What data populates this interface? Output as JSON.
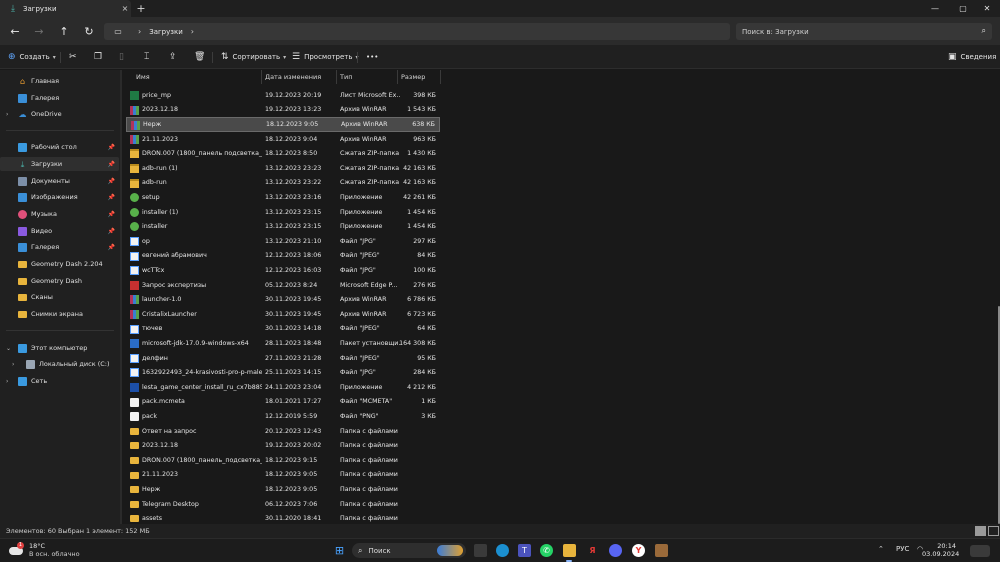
{
  "window": {
    "tab_title": "Загрузки",
    "new_tab": "+",
    "tab_close": "×",
    "controls": {
      "minimize": "—",
      "maximize": "▢",
      "close": "✕"
    }
  },
  "address": {
    "back": "←",
    "forward": "→",
    "up": "↑",
    "refresh": "↻",
    "breadcrumb": "Загрузки",
    "search_placeholder": "Поиск в: Загрузки"
  },
  "toolbar": {
    "new_label": "Создать",
    "sort_label": "Сортировать",
    "view_label": "Просмотреть",
    "more_label": "•••",
    "details_label": "Сведения"
  },
  "sidebar": {
    "items": [
      {
        "label": "Главная"
      },
      {
        "label": "Галерея"
      },
      {
        "label": "OneDrive"
      },
      {
        "label": "Рабочий стол"
      },
      {
        "label": "Загрузки"
      },
      {
        "label": "Документы"
      },
      {
        "label": "Изображения"
      },
      {
        "label": "Музыка"
      },
      {
        "label": "Видео"
      },
      {
        "label": "Галерея"
      },
      {
        "label": "Geometry Dash 2.204"
      },
      {
        "label": "Geometry Dash"
      },
      {
        "label": "Сканы"
      },
      {
        "label": "Снимки экрана"
      },
      {
        "label": "Этот компьютер"
      },
      {
        "label": "Локальный диск (C:)"
      },
      {
        "label": "Сеть"
      }
    ]
  },
  "columns": {
    "name": "Имя",
    "date": "Дата изменения",
    "type": "Тип",
    "size": "Размер"
  },
  "files": [
    {
      "name": "price_mp",
      "date": "19.12.2023 20:19",
      "type": "Лист Microsoft Ex...",
      "size": "398 КБ",
      "icon": "excel-icon"
    },
    {
      "name": "2023.12.18",
      "date": "19.12.2023 13:23",
      "type": "Архив WinRAR",
      "size": "1 543 КБ",
      "icon": "winrar-icon"
    },
    {
      "name": "Нерж",
      "date": "18.12.2023 9:05",
      "type": "Архив WinRAR",
      "size": "638 КБ",
      "icon": "winrar-icon"
    },
    {
      "name": "21.11.2023",
      "date": "18.12.2023 9:04",
      "type": "Архив WinRAR",
      "size": "963 КБ",
      "icon": "winrar-icon"
    },
    {
      "name": "DRON.007 (1800_панель подсветка_с_н...",
      "date": "18.12.2023 8:50",
      "type": "Сжатая ZIP-папка",
      "size": "1 430 КБ",
      "icon": "zip-folder-icon"
    },
    {
      "name": "adb-run (1)",
      "date": "13.12.2023 23:23",
      "type": "Сжатая ZIP-папка",
      "size": "42 163 КБ",
      "icon": "zip-folder-icon"
    },
    {
      "name": "adb-run",
      "date": "13.12.2023 23:22",
      "type": "Сжатая ZIP-папка",
      "size": "42 163 КБ",
      "icon": "zip-folder-icon"
    },
    {
      "name": "setup",
      "date": "13.12.2023 23:16",
      "type": "Приложение",
      "size": "42 261 КБ",
      "icon": "setup-icon"
    },
    {
      "name": "installer (1)",
      "date": "13.12.2023 23:15",
      "type": "Приложение",
      "size": "1 454 КБ",
      "icon": "installer-icon"
    },
    {
      "name": "installer",
      "date": "13.12.2023 23:15",
      "type": "Приложение",
      "size": "1 454 КБ",
      "icon": "installer-icon"
    },
    {
      "name": "op",
      "date": "13.12.2023 21:10",
      "type": "Файл \"JPG\"",
      "size": "297 КБ",
      "icon": "image-file-icon"
    },
    {
      "name": "евгений абрамович",
      "date": "12.12.2023 18:06",
      "type": "Файл \"JPEG\"",
      "size": "84 КБ",
      "icon": "image-file-icon"
    },
    {
      "name": "wcTTcx",
      "date": "12.12.2023 16:03",
      "type": "Файл \"JPG\"",
      "size": "100 КБ",
      "icon": "image-file-icon"
    },
    {
      "name": "Запрос экспертизы",
      "date": "05.12.2023 8:24",
      "type": "Microsoft Edge P...",
      "size": "276 КБ",
      "icon": "pdf-icon"
    },
    {
      "name": "launcher-1.0",
      "date": "30.11.2023 19:45",
      "type": "Архив WinRAR",
      "size": "6 786 КБ",
      "icon": "winrar-icon"
    },
    {
      "name": "CristalixLauncher",
      "date": "30.11.2023 19:45",
      "type": "Архив WinRAR",
      "size": "6 723 КБ",
      "icon": "winrar-icon"
    },
    {
      "name": "тючев",
      "date": "30.11.2023 14:18",
      "type": "Файл \"JPEG\"",
      "size": "64 КБ",
      "icon": "image-file-icon"
    },
    {
      "name": "microsoft-jdk-17.0.9-windows-x64",
      "date": "28.11.2023 18:48",
      "type": "Пакет установщи...",
      "size": "164 308 КБ",
      "icon": "msi-icon"
    },
    {
      "name": "делфин",
      "date": "27.11.2023 21:28",
      "type": "Файл \"JPEG\"",
      "size": "95 КБ",
      "icon": "image-file-icon"
    },
    {
      "name": "1632922493_24-krasivosti-pro-p-malenki...",
      "date": "25.11.2023 14:15",
      "type": "Файл \"JPG\"",
      "size": "284 КБ",
      "icon": "image-file-icon"
    },
    {
      "name": "lesta_game_center_install_ru_cx7b885jtqe8",
      "date": "24.11.2023 23:04",
      "type": "Приложение",
      "size": "4 212 КБ",
      "icon": "lesta-icon"
    },
    {
      "name": "pack.mcmeta",
      "date": "18.01.2021 17:27",
      "type": "Файл \"MCMETA\"",
      "size": "1 КБ",
      "icon": "file-icon"
    },
    {
      "name": "pack",
      "date": "12.12.2019 5:59",
      "type": "Файл \"PNG\"",
      "size": "3 КБ",
      "icon": "file-icon"
    },
    {
      "name": "Ответ на запрос",
      "date": "20.12.2023 12:43",
      "type": "Папка с файлами",
      "size": "",
      "icon": "folder-icon"
    },
    {
      "name": "2023.12.18",
      "date": "19.12.2023 20:02",
      "type": "Папка с файлами",
      "size": "",
      "icon": "folder-icon"
    },
    {
      "name": "DRON.007 (1800_панель_подсветка_с_н...",
      "date": "18.12.2023 9:15",
      "type": "Папка с файлами",
      "size": "",
      "icon": "folder-icon"
    },
    {
      "name": "21.11.2023",
      "date": "18.12.2023 9:05",
      "type": "Папка с файлами",
      "size": "",
      "icon": "folder-icon"
    },
    {
      "name": "Нерж",
      "date": "18.12.2023 9:05",
      "type": "Папка с файлами",
      "size": "",
      "icon": "folder-icon"
    },
    {
      "name": "Telegram Desktop",
      "date": "06.12.2023 7:06",
      "type": "Папка с файлами",
      "size": "",
      "icon": "folder-icon"
    },
    {
      "name": "assets",
      "date": "30.11.2020 18:41",
      "type": "Папка с файлами",
      "size": "",
      "icon": "folder-icon"
    }
  ],
  "status": {
    "items_count": "Элементов: 60",
    "selected": "Выбран 1 элемент: 152 МБ"
  },
  "taskbar": {
    "weather_temp": "18°C",
    "weather_desc": "В осн. облачно",
    "weather_badge": "1",
    "search_label": "Поиск",
    "language": "РУС",
    "time": "20:14",
    "date": "03.09.2024"
  }
}
